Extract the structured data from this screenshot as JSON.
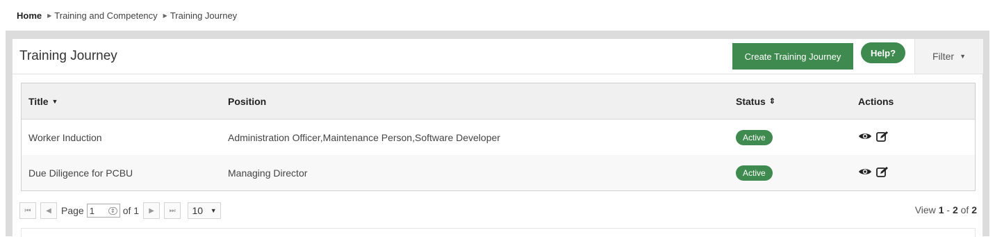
{
  "breadcrumb": {
    "home": "Home",
    "items": [
      "Training and Competency",
      "Training Journey"
    ]
  },
  "panel": {
    "title": "Training Journey",
    "create_button": "Create Training Journey",
    "help_button": "Help?",
    "filter_label": "Filter"
  },
  "table": {
    "columns": {
      "title": "Title",
      "position": "Position",
      "status": "Status",
      "actions": "Actions"
    },
    "rows": [
      {
        "title": "Worker Induction",
        "position": "Administration Officer,Maintenance Person,Software Developer",
        "status": "Active"
      },
      {
        "title": "Due Diligence for PCBU",
        "position": "Managing Director",
        "status": "Active"
      }
    ]
  },
  "pager": {
    "page_label": "Page",
    "page_value": "1",
    "of_label": "of 1",
    "rows_per_page": "10",
    "view_prefix": "View",
    "view_from": "1",
    "view_to": "2",
    "view_total": "2"
  },
  "colors": {
    "accent_green": "#3f8a4f"
  },
  "icons": [
    "sort-down-icon",
    "sort-both-icon",
    "eye-icon",
    "edit-icon",
    "first-page-icon",
    "prev-page-icon",
    "next-page-icon",
    "last-page-icon",
    "caret-down-icon"
  ]
}
